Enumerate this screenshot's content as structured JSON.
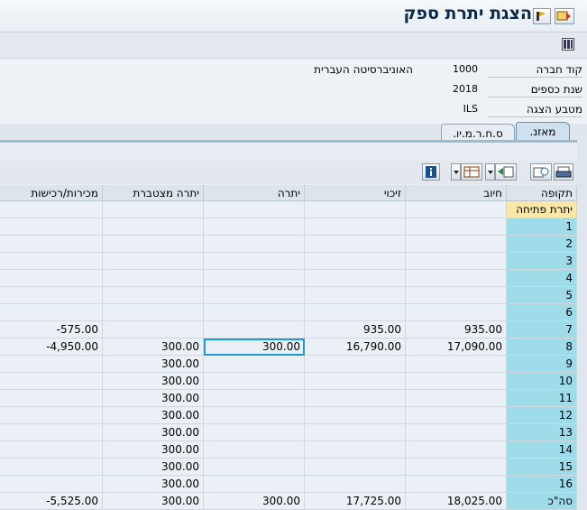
{
  "window": {
    "title": "הצגת יתרת ספק"
  },
  "form": {
    "fields": [
      {
        "label": "קוד חברה",
        "value": "1000",
        "description": "האוניברסיטה העברית"
      },
      {
        "label": "שנת כספים",
        "value": "2018",
        "description": ""
      },
      {
        "label": "מטבע הצגה",
        "value": "ILS",
        "description": ""
      }
    ]
  },
  "tabs": [
    {
      "label": "מאזנ."
    },
    {
      "label": "ס.ח.ר.מ.יו."
    }
  ],
  "table": {
    "columns": [
      "תקופה",
      "חיוב",
      "זיכוי",
      "יתרה",
      "יתרה מצטברת",
      "מכירות/רכישות"
    ],
    "rows": [
      {
        "period": "יתרת פתיחה",
        "debit": "",
        "credit": "",
        "balance": "",
        "cumulative": "",
        "sales": ""
      },
      {
        "period": "1",
        "debit": "",
        "credit": "",
        "balance": "",
        "cumulative": "",
        "sales": ""
      },
      {
        "period": "2",
        "debit": "",
        "credit": "",
        "balance": "",
        "cumulative": "",
        "sales": ""
      },
      {
        "period": "3",
        "debit": "",
        "credit": "",
        "balance": "",
        "cumulative": "",
        "sales": ""
      },
      {
        "period": "4",
        "debit": "",
        "credit": "",
        "balance": "",
        "cumulative": "",
        "sales": ""
      },
      {
        "period": "5",
        "debit": "",
        "credit": "",
        "balance": "",
        "cumulative": "",
        "sales": ""
      },
      {
        "period": "6",
        "debit": "",
        "credit": "",
        "balance": "",
        "cumulative": "",
        "sales": ""
      },
      {
        "period": "7",
        "debit": "935.00",
        "credit": "935.00",
        "balance": "",
        "cumulative": "",
        "sales": "-575.00"
      },
      {
        "period": "8",
        "debit": "17,090.00",
        "credit": "16,790.00",
        "balance": "300.00",
        "cumulative": "300.00",
        "sales": "-4,950.00"
      },
      {
        "period": "9",
        "debit": "",
        "credit": "",
        "balance": "",
        "cumulative": "300.00",
        "sales": ""
      },
      {
        "period": "10",
        "debit": "",
        "credit": "",
        "balance": "",
        "cumulative": "300.00",
        "sales": ""
      },
      {
        "period": "11",
        "debit": "",
        "credit": "",
        "balance": "",
        "cumulative": "300.00",
        "sales": ""
      },
      {
        "period": "12",
        "debit": "",
        "credit": "",
        "balance": "",
        "cumulative": "300.00",
        "sales": ""
      },
      {
        "period": "13",
        "debit": "",
        "credit": "",
        "balance": "",
        "cumulative": "300.00",
        "sales": ""
      },
      {
        "period": "14",
        "debit": "",
        "credit": "",
        "balance": "",
        "cumulative": "300.00",
        "sales": ""
      },
      {
        "period": "15",
        "debit": "",
        "credit": "",
        "balance": "",
        "cumulative": "300.00",
        "sales": ""
      },
      {
        "period": "16",
        "debit": "",
        "credit": "",
        "balance": "",
        "cumulative": "300.00",
        "sales": ""
      },
      {
        "period": "סה\"כ",
        "debit": "18,025.00",
        "credit": "17,725.00",
        "balance": "300.00",
        "cumulative": "300.00",
        "sales": "-5,525.00"
      }
    ]
  },
  "colors": {
    "key_column": "#9fdcea",
    "opening_row": "#fbe7a6",
    "selection": "#1a9ad6"
  }
}
